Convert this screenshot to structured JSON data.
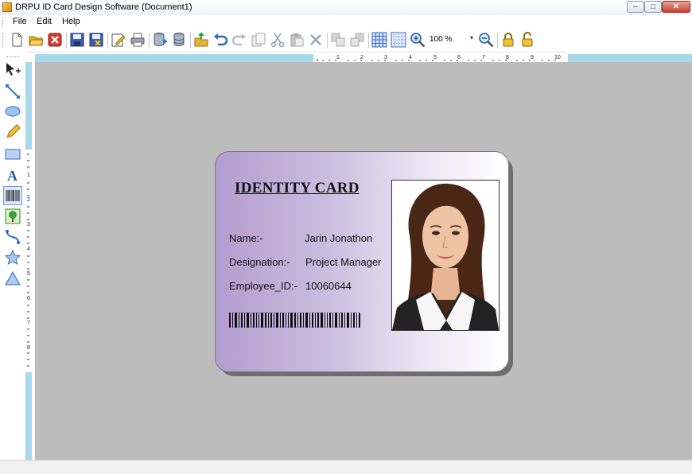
{
  "window": {
    "title": "DRPU ID Card Design Software  (Document1)",
    "min_glyph": "–",
    "max_glyph": "□",
    "close_glyph": "✕"
  },
  "menu": {
    "items": [
      "File",
      "Edit",
      "Help"
    ]
  },
  "toolbar": {
    "zoom_value": "100 %",
    "zoom_arrow": "▾",
    "buttons": [
      "new-icon",
      "open-folder-icon",
      "close-doc-icon",
      "save-icon",
      "save-as-icon",
      "edit-icon",
      "print-icon",
      "database-add-icon",
      "database-icon",
      "export-icon",
      "undo-icon",
      "redo-icon",
      "copy-format-icon",
      "cut-icon",
      "paste-icon",
      "delete-icon",
      "bring-front-icon",
      "send-back-icon",
      "grid-icon",
      "fit-grid-icon",
      "zoom-in-icon",
      "zoom-out-icon",
      "lock-icon",
      "unlock-icon"
    ]
  },
  "tools": [
    "pointer-icon",
    "line-icon",
    "ellipse-icon",
    "pencil-icon",
    "rectangle-icon",
    "text-icon",
    "barcode-icon",
    "picture-icon",
    "curve-icon",
    "star-icon",
    "triangle-icon"
  ],
  "ruler": {
    "h_labels": [
      "1",
      "2",
      "3",
      "4",
      "5",
      "6",
      "7",
      "8",
      "9",
      "10"
    ],
    "v_labels": [
      "1",
      "2",
      "3",
      "4",
      "5",
      "6",
      "7",
      "8"
    ]
  },
  "card": {
    "title": "IDENTITY CARD",
    "fields": [
      {
        "label": "Name:-",
        "value": "Jarin Jonathon"
      },
      {
        "label": "Designation:-",
        "value": "Project Manager"
      },
      {
        "label": "Employee_ID:-",
        "value": "10060644"
      }
    ],
    "gradient_start": "#b39ccf",
    "gradient_end": "#ffffff"
  },
  "colors": {
    "workspace": "#bcbcbc",
    "ruler": "#a9d8ea",
    "close_button": "#c7432f"
  }
}
